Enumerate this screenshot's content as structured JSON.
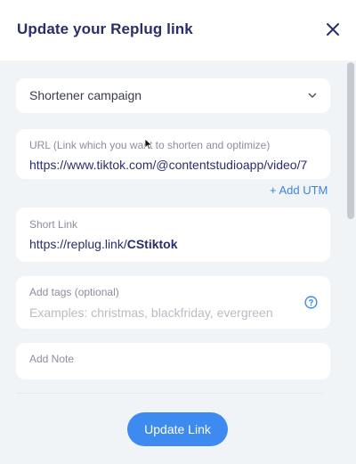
{
  "dialog": {
    "title": "Update your Replug link"
  },
  "campaign": {
    "selected": "Shortener campaign"
  },
  "url_field": {
    "label": "URL (Link which you want to shorten and optimize)",
    "value": "https://www.tiktok.com/@contentstudioapp/video/7"
  },
  "add_utm_label": "+ Add UTM",
  "short_link": {
    "label": "Short Link",
    "prefix": "https://replug.link/",
    "slug": "CStiktok"
  },
  "tags": {
    "label": "Add tags (optional)",
    "placeholder": "Examples: christmas, blackfriday, evergreen"
  },
  "note": {
    "label": "Add Note"
  },
  "update_button": "Update Link",
  "colors": {
    "accent": "#3d8bf0",
    "title": "#2b2e6b"
  },
  "icons": [
    "close-icon",
    "chevron-down-icon",
    "help-icon",
    "mouse-cursor-icon"
  ]
}
